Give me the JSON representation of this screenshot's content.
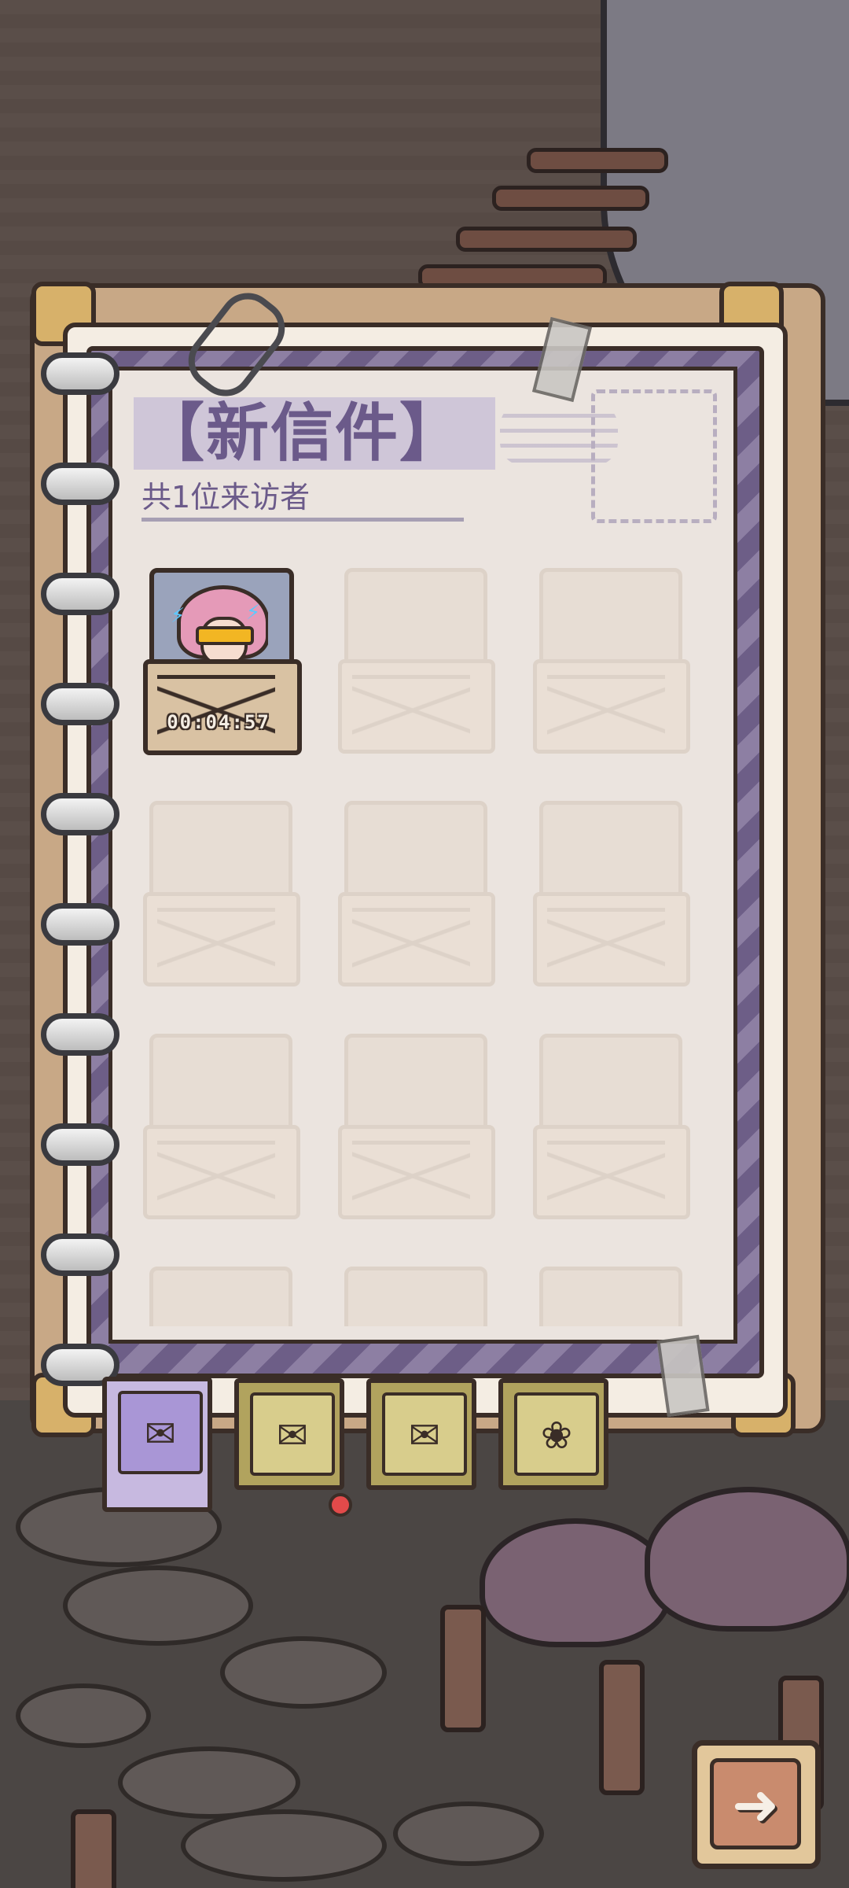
{
  "header": {
    "title": "【新信件】",
    "subtitle": "共1位来访者"
  },
  "letters": {
    "visitor": {
      "timer": "00:04:57",
      "avatar_icon": "visitor-portrait"
    },
    "empty_slots": 8
  },
  "tabs": [
    {
      "name": "new-letters-tab",
      "icon": "envelope-icon",
      "active": true
    },
    {
      "name": "sealed-letters-tab",
      "icon": "sealed-envelope-icon",
      "active": false,
      "has_notification": true
    },
    {
      "name": "opened-letters-tab",
      "icon": "open-envelope-icon",
      "active": false
    },
    {
      "name": "collection-tab",
      "icon": "card-collection-icon",
      "active": false
    }
  ],
  "next_button": {
    "icon": "arrow-right-icon"
  },
  "colors": {
    "accent_purple": "#6b5a8a",
    "tab_active": "#c7b9e0",
    "notification": "#e24a4a"
  }
}
